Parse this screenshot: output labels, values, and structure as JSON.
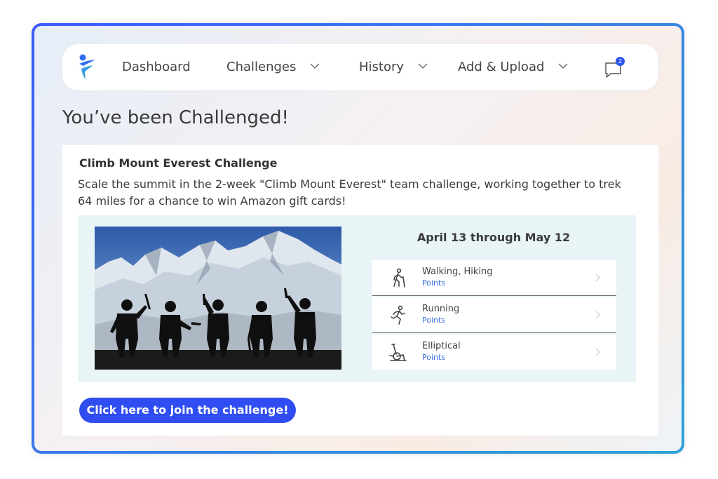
{
  "nav": {
    "dashboard": "Dashboard",
    "challenges": "Challenges",
    "history": "History",
    "add_upload": "Add & Upload",
    "message_count": "2"
  },
  "page_title": "You’ve been Challenged!",
  "challenge": {
    "title": "Climb Mount Everest Challenge",
    "description": "Scale the summit in the 2-week \"Climb Mount Everest\" team challenge, working together to trek 64 miles for a chance to win Amazon gift cards!",
    "dates": "April 13 through May 12",
    "activities": [
      {
        "name": "Walking, Hiking",
        "sub": "Points",
        "icon": "walking-icon"
      },
      {
        "name": "Running",
        "sub": "Points",
        "icon": "running-icon"
      },
      {
        "name": "Elliptical",
        "sub": "Points",
        "icon": "elliptical-icon"
      }
    ],
    "join_label": "Click here to join the challenge!"
  },
  "colors": {
    "accent": "#2f4df0",
    "link": "#3b6fd8",
    "panel": "#e8f4f5"
  }
}
